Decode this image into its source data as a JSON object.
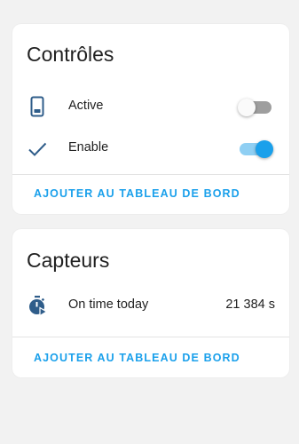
{
  "colors": {
    "accent": "#1aa0eb",
    "icon": "#2f5d8a",
    "background": "#f2f2f2",
    "card": "#ffffff"
  },
  "controls": {
    "title": "Contrôles",
    "items": [
      {
        "icon": "phone-icon",
        "label": "Active",
        "state": "off"
      },
      {
        "icon": "check-icon",
        "label": "Enable",
        "state": "on"
      }
    ],
    "action_label": "AJOUTER AU TABLEAU DE BORD"
  },
  "sensors": {
    "title": "Capteurs",
    "items": [
      {
        "icon": "timer-play-icon",
        "label": "On time today",
        "value": "21 384 s"
      }
    ],
    "action_label": "AJOUTER AU TABLEAU DE BORD"
  }
}
